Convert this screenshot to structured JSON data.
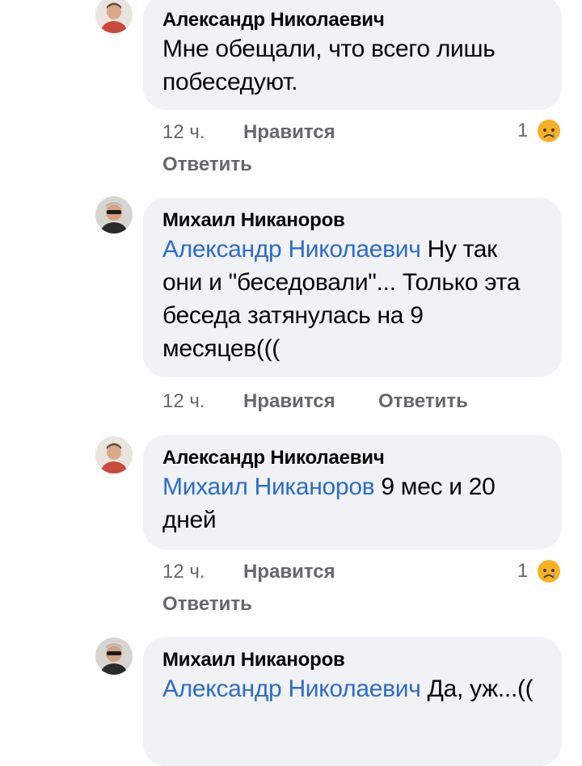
{
  "comments": [
    {
      "author": "Александр Николаевич",
      "mention": "",
      "text": "Мне обещали,  что всего лишь побеседуют.",
      "time": "12 ч.",
      "like_label": "Нравится",
      "reply_label": "Ответить",
      "reaction_count": "1",
      "reaction_icon": "sad-reaction-icon",
      "avatar_color": "#c84a3a"
    },
    {
      "author": "Михаил Никаноров",
      "mention": "Александр Николаевич",
      "text": " Ну так они и \"беседовали\"... Только эта беседа затянулась на 9 месяцев(((",
      "time": "12 ч.",
      "like_label": "Нравится",
      "reply_label": "Ответить",
      "reaction_count": "",
      "avatar_color": "#2a2a2a"
    },
    {
      "author": "Александр Николаевич",
      "mention": "Михаил Никаноров",
      "text": " 9 мес и 20 дней",
      "time": "12 ч.",
      "like_label": "Нравится",
      "reply_label": "Ответить",
      "reaction_count": "1",
      "reaction_icon": "sad-reaction-icon",
      "avatar_color": "#c84a3a"
    },
    {
      "author": "Михаил Никаноров",
      "mention": "Александр Николаевич",
      "text": " Да, уж...((",
      "time": "",
      "like_label": "",
      "reply_label": "",
      "reaction_count": "",
      "avatar_color": "#2a2a2a"
    }
  ],
  "colors": {
    "bubble": "#f0f2f5",
    "mention": "#2d6bc9",
    "meta": "#65676b",
    "reaction_face": "#f7b125"
  }
}
